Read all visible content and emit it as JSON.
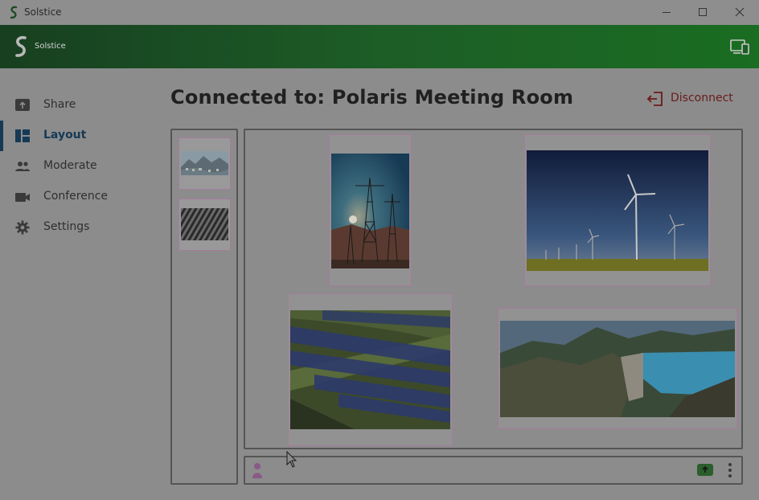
{
  "window": {
    "title": "Solstice",
    "controls": [
      "minimize-icon",
      "maximize-icon",
      "close-icon"
    ]
  },
  "header": {
    "brand": "Solstice",
    "icons": [
      "solstice-logo",
      "device-icon"
    ],
    "colors": {
      "gradient_start": "#173f20",
      "gradient_end": "#1a6d22"
    }
  },
  "sidebar": {
    "items": [
      {
        "label": "Share",
        "icon": "share-icon",
        "active": false
      },
      {
        "label": "Layout",
        "icon": "layout-icon",
        "active": true
      },
      {
        "label": "Moderate",
        "icon": "people-icon",
        "active": false
      },
      {
        "label": "Conference",
        "icon": "camera-icon",
        "active": false
      },
      {
        "label": "Settings",
        "icon": "gear-icon",
        "active": false
      }
    ]
  },
  "main": {
    "title": "Connected to: Polaris Meeting Room",
    "disconnect_label": "Disconnect",
    "disconnect_color": "#6b1a1a"
  },
  "strip": {
    "thumbnails": [
      "mountain-village-thumbnail",
      "pattern-thumbnail"
    ]
  },
  "canvas": {
    "tiles": [
      "power-tower-image",
      "wind-turbines-image",
      "solar-farm-image",
      "dam-lake-image"
    ]
  },
  "bottombar": {
    "icons": [
      "user-icon",
      "share-badge-icon",
      "more-options-icon"
    ]
  }
}
